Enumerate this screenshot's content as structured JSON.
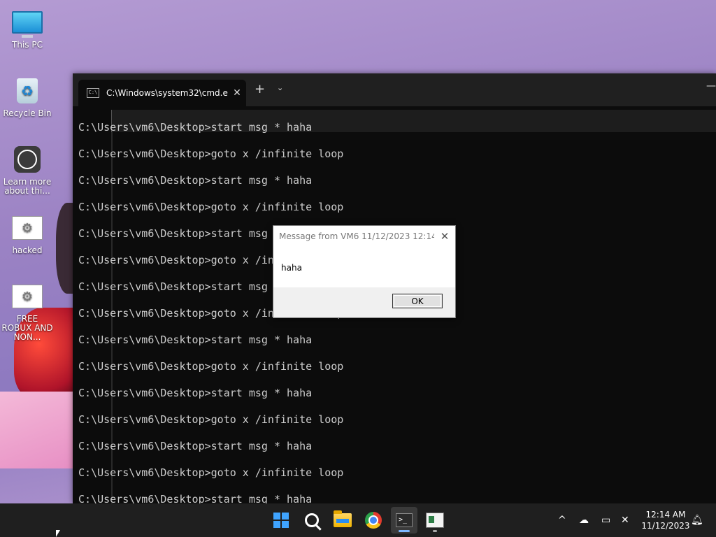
{
  "desktop": {
    "icons": [
      {
        "label": "This PC",
        "icon": "this-pc-icon"
      },
      {
        "label": "Recycle Bin",
        "icon": "recycle-bin-icon"
      },
      {
        "label": "Learn more about thi...",
        "icon": "learn-more-icon"
      },
      {
        "label": "hacked",
        "icon": "batch-file-icon"
      },
      {
        "label": "FREE ROBUX AND NON...",
        "icon": "batch-file-icon"
      }
    ]
  },
  "terminal": {
    "tab_title": "C:\\Windows\\system32\\cmd.e:",
    "tab_close": "✕",
    "new_tab": "+",
    "dropdown": "⌄",
    "minimize": "—",
    "lines": [
      "C:\\Users\\vm6\\Desktop>start msg * haha",
      "C:\\Users\\vm6\\Desktop>goto x /infinite loop",
      "C:\\Users\\vm6\\Desktop>start msg * haha",
      "C:\\Users\\vm6\\Desktop>goto x /infinite loop",
      "C:\\Users\\vm6\\Desktop>start msg * haha",
      "C:\\Users\\vm6\\Desktop>goto x /infinite loop",
      "C:\\Users\\vm6\\Desktop>start msg * haha",
      "C:\\Users\\vm6\\Desktop>goto x /infinite loop",
      "C:\\Users\\vm6\\Desktop>start msg * haha",
      "C:\\Users\\vm6\\Desktop>goto x /infinite loop",
      "C:\\Users\\vm6\\Desktop>start msg * haha",
      "C:\\Users\\vm6\\Desktop>goto x /infinite loop",
      "C:\\Users\\vm6\\Desktop>start msg * haha",
      "C:\\Users\\vm6\\Desktop>goto x /infinite loop",
      "C:\\Users\\vm6\\Desktop>start msg * haha"
    ]
  },
  "dialog": {
    "title": "Message from VM6 11/12/2023 12:14...",
    "close": "✕",
    "message": "haha",
    "ok_label": "OK"
  },
  "taskbar": {
    "apps": [
      "start-icon",
      "search-icon",
      "file-explorer-icon",
      "chrome-icon",
      "terminal-icon",
      "app-icon"
    ],
    "tray_chevron": "^",
    "time": "12:14 AM",
    "date": "11/12/2023"
  },
  "colors": {
    "terminal_bg": "#0c0c0c",
    "terminal_text": "#cccccc",
    "taskbar_bg": "#1f1f1f",
    "start_blue": "#3fa4ff"
  }
}
